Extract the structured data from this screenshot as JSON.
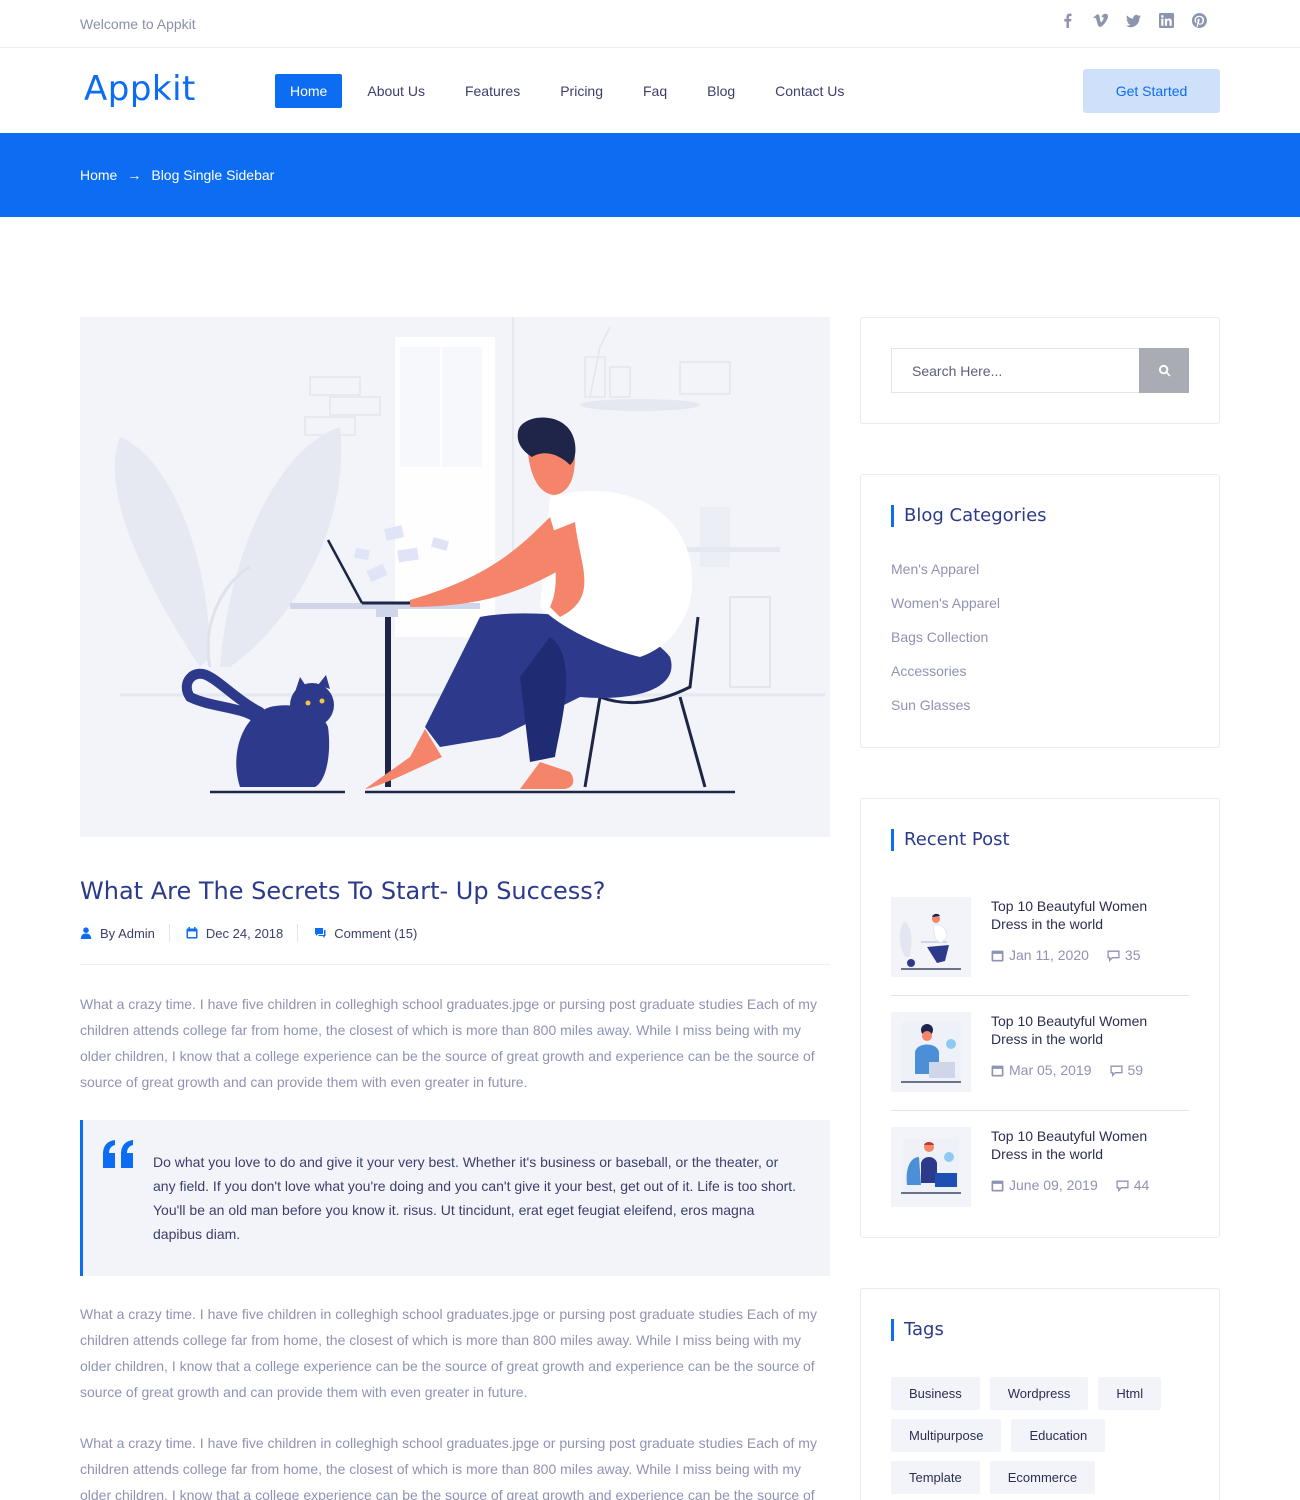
{
  "topbar": {
    "welcome": "Welcome to Appkit",
    "socials": [
      "facebook-icon",
      "vimeo-icon",
      "twitter-icon",
      "linkedin-icon",
      "pinterest-icon"
    ]
  },
  "header": {
    "logo": "Appkit",
    "nav": [
      {
        "label": "Home",
        "active": true
      },
      {
        "label": "About Us"
      },
      {
        "label": "Features"
      },
      {
        "label": "Pricing"
      },
      {
        "label": "Faq"
      },
      {
        "label": "Blog"
      },
      {
        "label": "Contact Us"
      }
    ],
    "cta": "Get Started"
  },
  "breadcrumb": {
    "home": "Home",
    "arrow": "→",
    "current": "Blog Single Sidebar"
  },
  "colors": {
    "primary": "#0c6cf2",
    "heading": "#2c3a8c",
    "muted": "#8f93b3"
  },
  "article": {
    "title": "What Are The Secrets To Start- Up Success?",
    "author": "By Admin",
    "date": "Dec 24, 2018",
    "comments": "Comment (15)",
    "paragraph": "What a crazy time. I have five children in colleghigh school graduates.jpge or pursing post graduate studies Each of my children attends college far from home, the closest of which is more than 800 miles away. While I miss being with my older children, I know that a college experience can be the source of great growth and experience can be the source of source of great growth and can provide them with even greater in future.",
    "quote": "Do what you love to do and give it your very best. Whether it's business or baseball, or the theater, or any field. If you don't love what you're doing and you can't give it your best, get out of it. Life is too short. You'll be an old man before you know it. risus. Ut tincidunt, erat eget feugiat eleifend, eros magna dapibus diam."
  },
  "sidebar": {
    "search": {
      "placeholder": "Search Here..."
    },
    "categories": {
      "title": "Blog Categories",
      "items": [
        "Men's Apparel",
        "Women's Apparel",
        "Bags Collection",
        "Accessories",
        "Sun Glasses"
      ]
    },
    "recent": {
      "title": "Recent Post",
      "posts": [
        {
          "title": "Top 10 Beautyful Women Dress in the world",
          "date": "Jan 11, 2020",
          "comments": "35"
        },
        {
          "title": "Top 10 Beautyful Women Dress in the world",
          "date": "Mar 05, 2019",
          "comments": "59"
        },
        {
          "title": "Top 10 Beautyful Women Dress in the world",
          "date": "June 09, 2019",
          "comments": "44"
        }
      ]
    },
    "tags": {
      "title": "Tags",
      "items": [
        "Business",
        "Wordpress",
        "Html",
        "Multipurpose",
        "Education",
        "Template",
        "Ecommerce"
      ]
    }
  }
}
